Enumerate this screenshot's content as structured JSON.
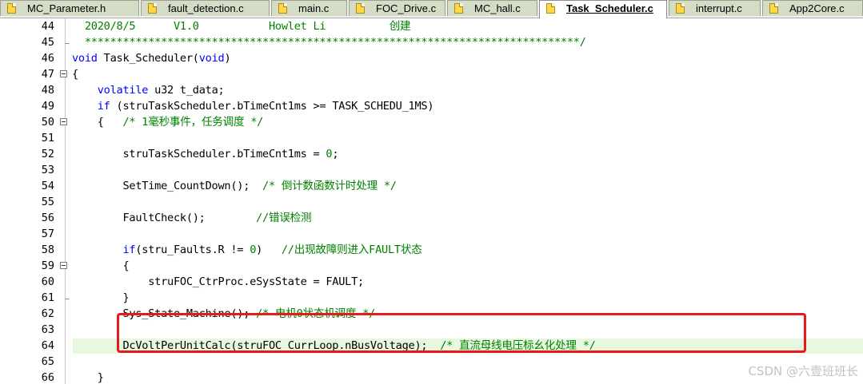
{
  "tabs": [
    {
      "label": "MC_Parameter.h",
      "active": false
    },
    {
      "label": "fault_detection.c",
      "active": false
    },
    {
      "label": "main.c",
      "active": false
    },
    {
      "label": "FOC_Drive.c",
      "active": false
    },
    {
      "label": "MC_hall.c",
      "active": false
    },
    {
      "label": "Task_Scheduler.c",
      "active": true
    },
    {
      "label": "interrupt.c",
      "active": false
    },
    {
      "label": "App2Core.c",
      "active": false
    }
  ],
  "editor": {
    "current_line": 64,
    "lines": [
      {
        "n": "44",
        "segs": [
          [
            "hdr",
            "  2020/8/5      V1.0           Howlet Li          创建"
          ]
        ]
      },
      {
        "n": "45",
        "segs": [
          [
            "cm",
            "  ******************************************************************************/"
          ]
        ]
      },
      {
        "n": "46",
        "segs": [
          [
            "kw",
            "void"
          ],
          [
            "",
            " Task_Scheduler("
          ],
          [
            "kw",
            "void"
          ],
          [
            "",
            ")"
          ]
        ]
      },
      {
        "n": "47",
        "segs": [
          [
            "",
            "{"
          ]
        ]
      },
      {
        "n": "48",
        "segs": [
          [
            "",
            "    "
          ],
          [
            "kw",
            "volatile"
          ],
          [
            "",
            " u32 t_data;"
          ]
        ]
      },
      {
        "n": "49",
        "segs": [
          [
            "",
            "    "
          ],
          [
            "kw",
            "if"
          ],
          [
            "",
            " (struTaskScheduler.bTimeCnt1ms >= TASK_SCHEDU_1MS)"
          ]
        ]
      },
      {
        "n": "50",
        "segs": [
          [
            "",
            "    {   "
          ],
          [
            "cm",
            "/* 1毫秒事件，任务调度 */"
          ]
        ]
      },
      {
        "n": "51",
        "segs": [
          [
            "",
            ""
          ]
        ]
      },
      {
        "n": "52",
        "segs": [
          [
            "",
            "        struTaskScheduler.bTimeCnt1ms = "
          ],
          [
            "num",
            "0"
          ],
          [
            "",
            ";"
          ]
        ]
      },
      {
        "n": "53",
        "segs": [
          [
            "",
            ""
          ]
        ]
      },
      {
        "n": "54",
        "segs": [
          [
            "",
            "        SetTime_CountDown();  "
          ],
          [
            "cm",
            "/* 倒计数函数计时处理 */"
          ]
        ]
      },
      {
        "n": "55",
        "segs": [
          [
            "",
            ""
          ]
        ]
      },
      {
        "n": "56",
        "segs": [
          [
            "",
            "        FaultCheck();        "
          ],
          [
            "cm",
            "//错误检测"
          ]
        ]
      },
      {
        "n": "57",
        "segs": [
          [
            "",
            ""
          ]
        ]
      },
      {
        "n": "58",
        "segs": [
          [
            "",
            "        "
          ],
          [
            "kw",
            "if"
          ],
          [
            "",
            "(stru_Faults.R != "
          ],
          [
            "num",
            "0"
          ],
          [
            "",
            ")   "
          ],
          [
            "cm",
            "//出现故障则进入FAULT状态"
          ]
        ]
      },
      {
        "n": "59",
        "segs": [
          [
            "",
            "        {"
          ]
        ]
      },
      {
        "n": "60",
        "segs": [
          [
            "",
            "            struFOC_CtrProc.eSysState = FAULT;"
          ]
        ]
      },
      {
        "n": "61",
        "segs": [
          [
            "",
            "        }"
          ]
        ]
      },
      {
        "n": "62",
        "segs": [
          [
            "",
            "        Sys_State_Machine(); "
          ],
          [
            "cm",
            "/* 电机0状态机调度 */"
          ]
        ]
      },
      {
        "n": "63",
        "segs": [
          [
            "",
            ""
          ]
        ]
      },
      {
        "n": "64",
        "segs": [
          [
            "",
            "        DcVoltPerUnitCalc(struFOC_CurrLoop.nBusVoltage);  "
          ],
          [
            "cm",
            "/* 直流母线电压标幺化处理 */"
          ]
        ]
      },
      {
        "n": "65",
        "segs": [
          [
            "",
            ""
          ]
        ]
      },
      {
        "n": "66",
        "segs": [
          [
            "",
            "    }"
          ]
        ]
      }
    ],
    "fold_open": [
      "47",
      "50",
      "59"
    ],
    "fold_end": [
      "45",
      "61"
    ]
  },
  "watermark": "CSDN @六壹班班长",
  "colors": {
    "keyword": "#0000ff",
    "comment": "#008000",
    "highlight": "#e6f8e0",
    "annotation": "#e8191c"
  }
}
